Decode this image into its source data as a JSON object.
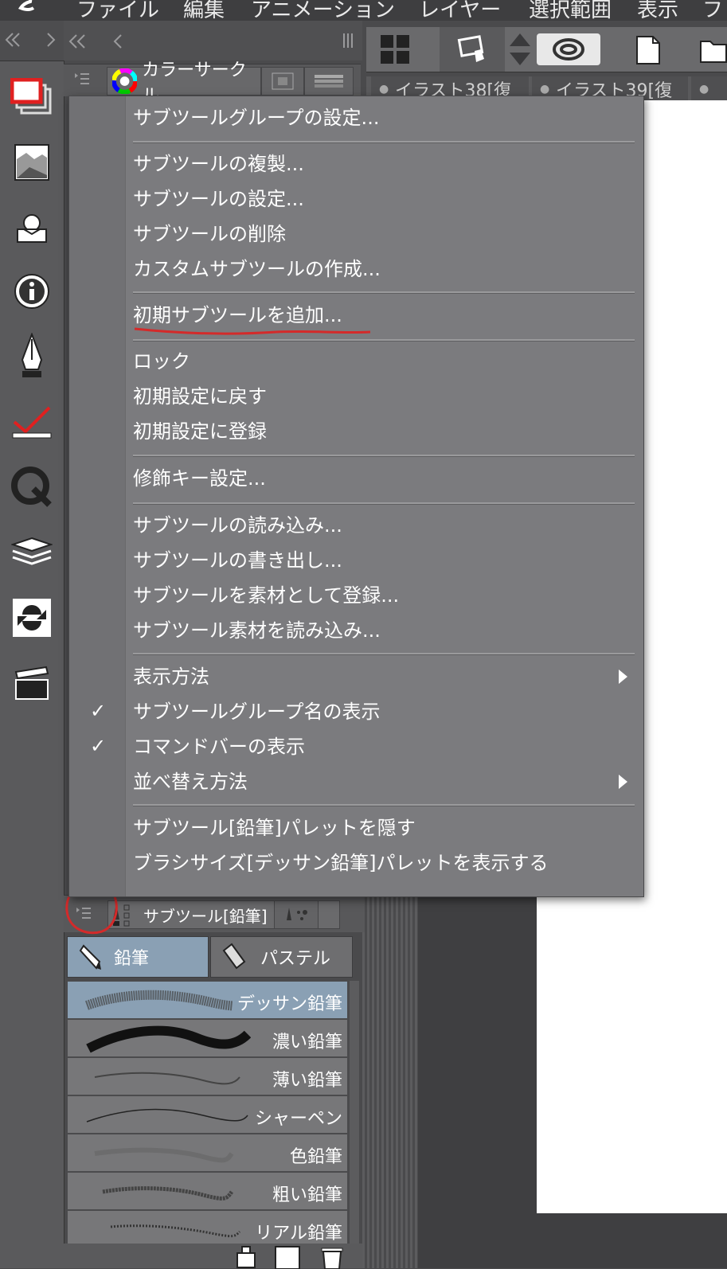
{
  "menubar": {
    "items": [
      "ファイル",
      "編集",
      "アニメーション",
      "レイヤー",
      "選択範囲",
      "表示",
      "フ"
    ]
  },
  "color_panel": {
    "tab_label": "カラーサークル"
  },
  "doc_tabs": [
    "イラスト38[復",
    "イラスト39[復"
  ],
  "context_menu": {
    "groups": [
      [
        "サブツールグループの設定..."
      ],
      [
        "サブツールの複製...",
        "サブツールの設定...",
        "サブツールの削除",
        "カスタムサブツールの作成..."
      ],
      [
        "初期サブツールを追加..."
      ],
      [
        "ロック",
        "初期設定に戻す",
        "初期設定に登録"
      ],
      [
        "修飾キー設定..."
      ],
      [
        "サブツールの読み込み...",
        "サブツールの書き出し...",
        "サブツールを素材として登録...",
        "サブツール素材を読み込み..."
      ],
      [
        "表示方法",
        "サブツールグループ名の表示",
        "コマンドバーの表示",
        "並べ替え方法"
      ],
      [
        "サブツール[鉛筆]パレットを隠す",
        "ブラシサイズ[デッサン鉛筆]パレットを表示する"
      ]
    ],
    "checked": [
      "サブツールグループ名の表示",
      "コマンドバーの表示"
    ],
    "submenu": [
      "表示方法",
      "並べ替え方法"
    ],
    "highlighted": "初期サブツールを追加...",
    "annotation_color": "#d42a2a"
  },
  "subtool_panel": {
    "header": "サブツール[鉛筆]",
    "groups": [
      "鉛筆",
      "パステル"
    ],
    "selected_group": "鉛筆",
    "items": [
      "デッサン鉛筆",
      "濃い鉛筆",
      "薄い鉛筆",
      "シャーペン",
      "色鉛筆",
      "粗い鉛筆",
      "リアル鉛筆"
    ],
    "selected_item": "デッサン鉛筆"
  },
  "colors": {
    "selection": "#8aa0b4",
    "annotation": "#d42a2a"
  }
}
